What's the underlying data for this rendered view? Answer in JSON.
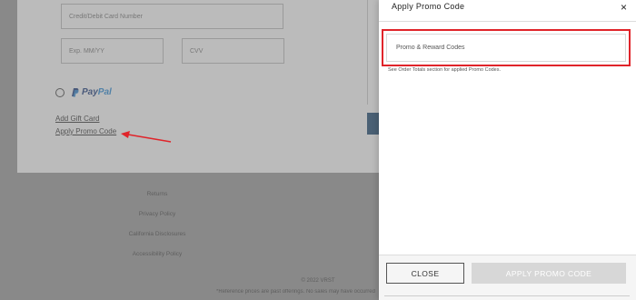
{
  "checkout": {
    "card_number_placeholder": "Credit/Debit Card Number",
    "exp_placeholder": "Exp. MM/YY",
    "cvv_placeholder": "CVV",
    "paypal_pay": "Pay",
    "paypal_pal": "Pal",
    "add_gift_card": "Add Gift Card",
    "apply_promo_code": "Apply Promo Code"
  },
  "footer": {
    "links": [
      "Returns",
      "Privacy Policy",
      "California Disclosures",
      "Accessibility Policy"
    ],
    "copyright": "© 2022 VRST",
    "disclaimer": "*Reference prices are past offerings. No sales may have occurred"
  },
  "modal": {
    "title": "Apply Promo Code",
    "close_icon": "×",
    "input_placeholder": "Promo & Reward Codes",
    "help_text": "See Order Totals section for applied Promo Codes.",
    "close_button": "CLOSE",
    "apply_button": "APPLY PROMO CODE"
  },
  "colors": {
    "highlight": "#e0242a",
    "annotation_arrow": "#e0242a",
    "paypal_dark": "#1b3b7c",
    "paypal_light": "#2a8ad6",
    "apply_disabled": "#d7d7d7"
  },
  "icons": [
    "close-icon",
    "paypal-icon",
    "radio-button",
    "annotation-arrow"
  ]
}
